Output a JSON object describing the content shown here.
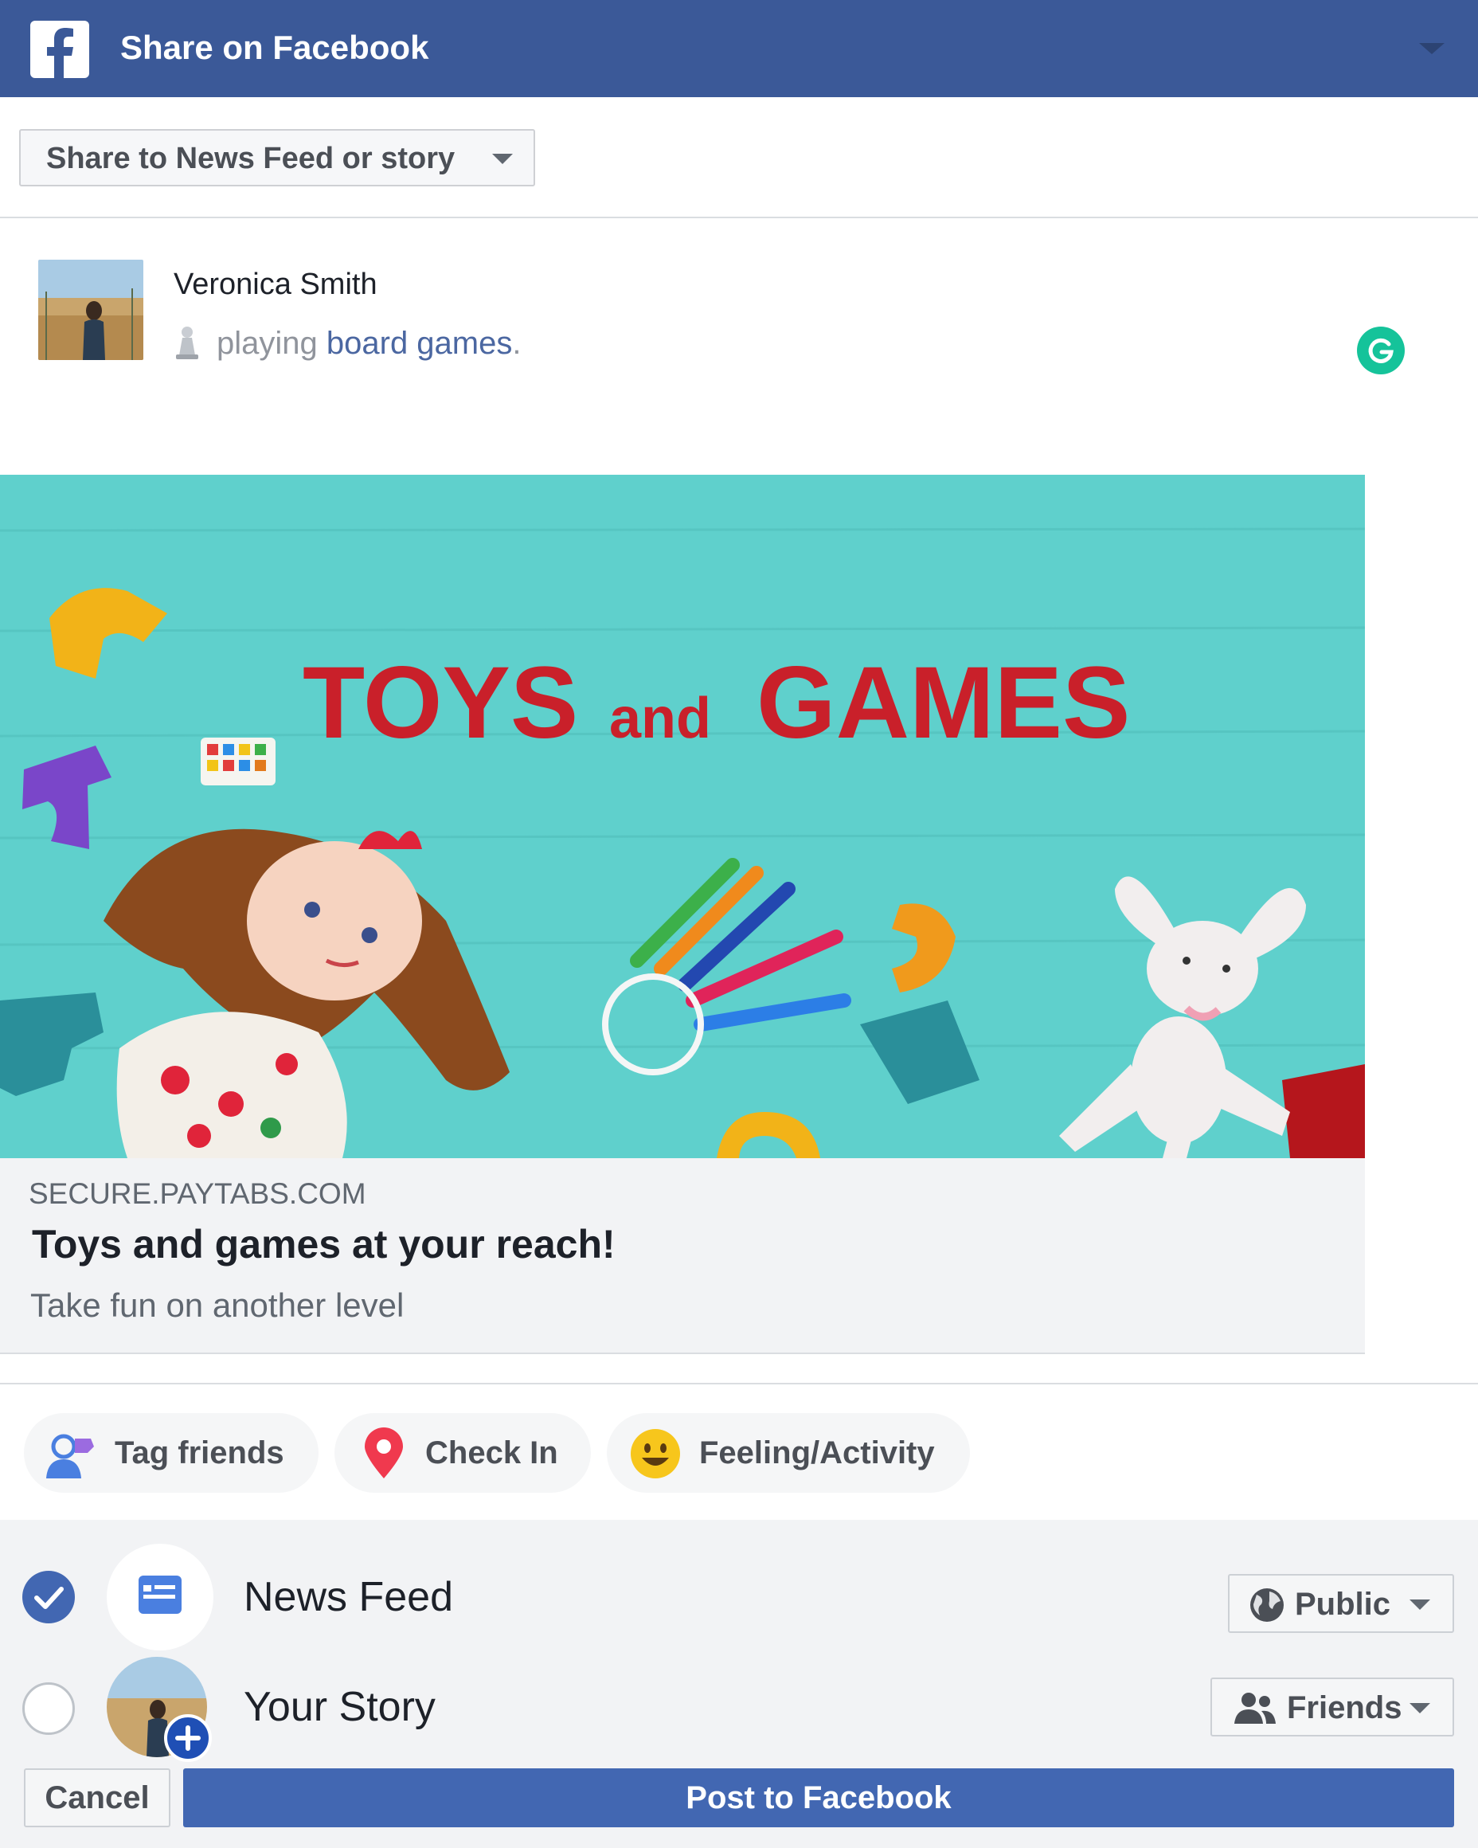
{
  "header": {
    "title": "Share on Facebook",
    "icon": "facebook-logo-icon",
    "brand_color": "#3b5998"
  },
  "share_destination": {
    "selected": "Share to News Feed or story"
  },
  "composer": {
    "user_name": "Veronica Smith",
    "activity_verb": "playing",
    "activity_object": "board games",
    "activity_suffix": ".",
    "activity_icon": "board-game-pawn-icon",
    "extension_icon": "grammarly-icon"
  },
  "link_preview": {
    "image_heading_main": "TOYS",
    "image_heading_and": "and",
    "image_heading_end": "GAMES",
    "domain": "SECURE.PAYTABS.COM",
    "title": "Toys and games at your reach!",
    "description": "Take fun on another level"
  },
  "actions": [
    {
      "label": "Tag friends",
      "icon": "tag-friends-icon"
    },
    {
      "label": "Check In",
      "icon": "location-pin-icon"
    },
    {
      "label": "Feeling/Activity",
      "icon": "smiley-icon"
    }
  ],
  "audience": {
    "news_feed": {
      "label": "News Feed",
      "checked": true,
      "privacy": "Public",
      "privacy_icon": "globe-icon"
    },
    "your_story": {
      "label": "Your Story",
      "checked": false,
      "privacy": "Friends",
      "privacy_icon": "friends-icon"
    }
  },
  "buttons": {
    "cancel": "Cancel",
    "post": "Post to Facebook"
  },
  "colors": {
    "accent": "#4267b2",
    "check_blue": "#4267b2",
    "banner_red": "#c9202a",
    "banner_bg": "#5fd0cc",
    "grammarly_green": "#15c39a"
  }
}
